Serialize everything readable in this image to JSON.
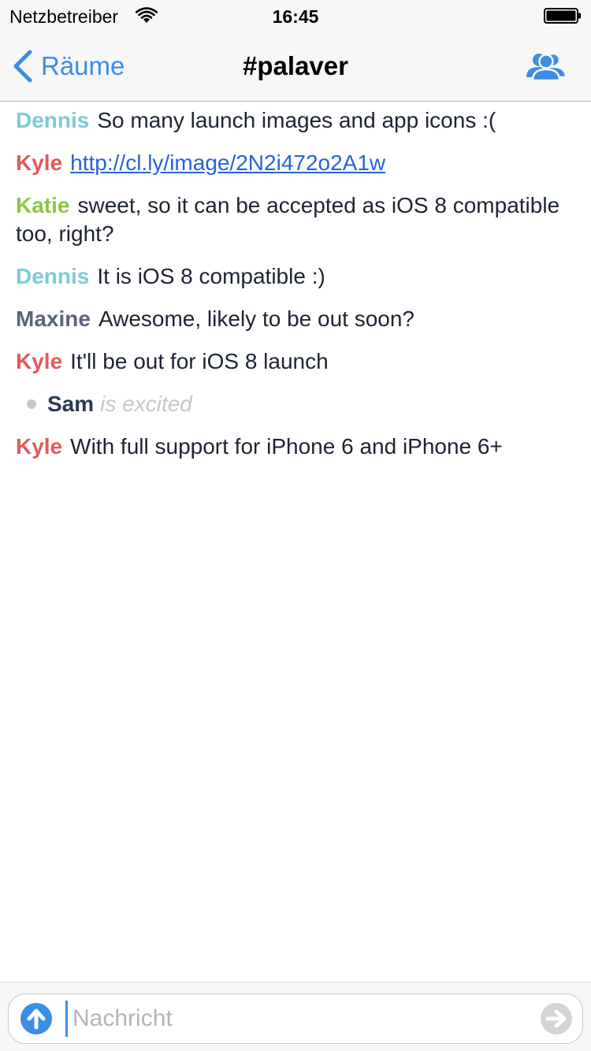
{
  "status_bar": {
    "carrier": "Netzbetreiber",
    "time": "16:45"
  },
  "nav": {
    "back_label": "Räume",
    "title": "#palaver"
  },
  "colors": {
    "accent": "#3a8ee6",
    "nick_dennis": "#7fcbd6",
    "nick_kyle": "#e05a5a",
    "nick_katie": "#8dc63f",
    "nick_maxine": "#5a6478",
    "link": "#2a62d6"
  },
  "messages": [
    {
      "nick": "Dennis",
      "text": "So many launch images and app icons :("
    },
    {
      "nick": "Kyle",
      "link": "http://cl.ly/image/2N2i472o2A1w"
    },
    {
      "nick": "Katie",
      "text": "sweet, so it can be accepted as iOS 8 compatible too, right?"
    },
    {
      "nick": "Dennis",
      "text": "It is iOS 8 compatible :)"
    },
    {
      "nick": "Maxine",
      "text": "Awesome, likely to be out soon?"
    },
    {
      "nick": "Kyle",
      "text": "It'll be out for iOS 8 launch"
    },
    {
      "action_nick": "Sam",
      "action_text": "is excited"
    },
    {
      "nick": "Kyle",
      "text": "With full support for iPhone 6 and iPhone 6+"
    }
  ],
  "composer": {
    "placeholder": "Nachricht",
    "upload_icon": "upload-arrow-icon",
    "send_icon": "send-arrow-icon"
  }
}
